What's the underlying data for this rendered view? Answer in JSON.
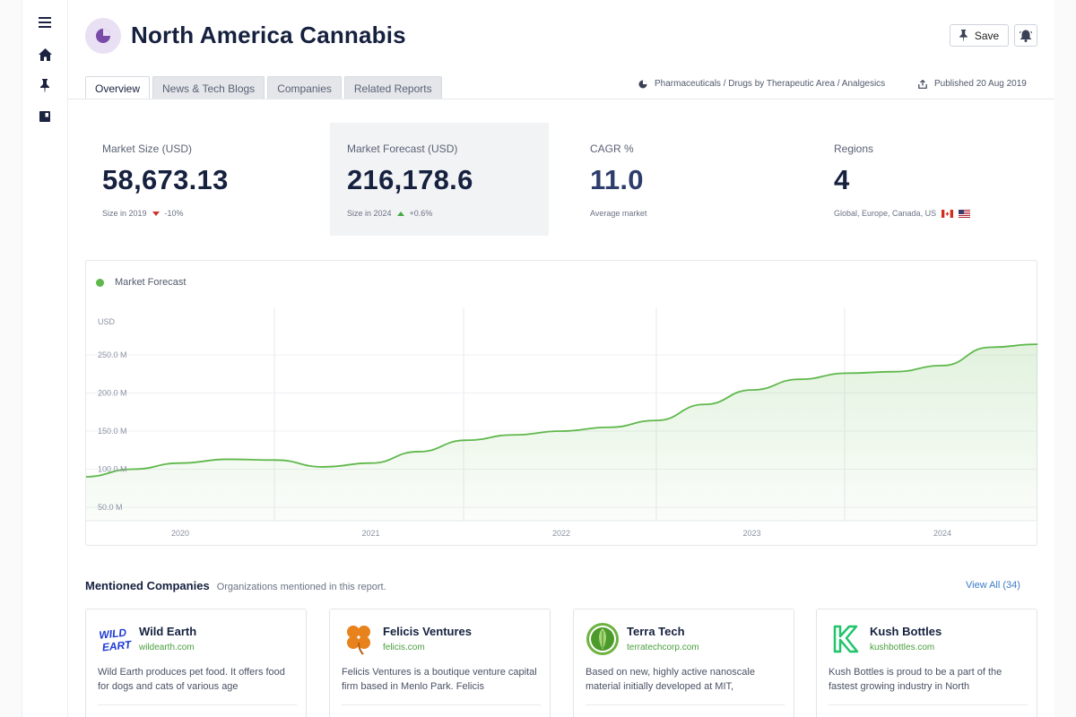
{
  "sidebar": {
    "items": [
      {
        "icon": "menu-icon"
      },
      {
        "icon": "home-icon"
      },
      {
        "icon": "pin-icon"
      },
      {
        "icon": "book-icon"
      }
    ]
  },
  "header": {
    "title": "North America Cannabis",
    "save_label": "Save"
  },
  "tabs": [
    {
      "label": "Overview",
      "active": true
    },
    {
      "label": "News & Tech Blogs",
      "active": false
    },
    {
      "label": "Companies",
      "active": false
    },
    {
      "label": "Related Reports",
      "active": false
    }
  ],
  "meta": {
    "category": "Pharmaceuticals / Drugs by Therapeutic Area / Analgesics",
    "published": "Published 20 Aug 2019"
  },
  "stats": {
    "market_size": {
      "label": "Market Size (USD)",
      "value": "58,673.13",
      "sub": "Size in 2019",
      "change": "-10%"
    },
    "market_forecast": {
      "label": "Market Forecast (USD)",
      "value": "216,178.6",
      "sub": "Size in 2024",
      "change": "+0.6%"
    },
    "cagr": {
      "label": "CAGR %",
      "value": "11.0",
      "sub": "Average market"
    },
    "regions": {
      "label": "Regions",
      "value": "4",
      "sub": "Global, Europe, Canada, US"
    }
  },
  "chart_data": {
    "type": "area",
    "legend": [
      "Market Forecast"
    ],
    "ylabel": "USD",
    "y_ticks": [
      "250.0 M",
      "200.0 M",
      "150.0 M",
      "100.0 M",
      "50.0 M"
    ],
    "x_ticks": [
      "2020",
      "2021",
      "2022",
      "2023",
      "2024"
    ],
    "ylim": [
      50,
      270
    ],
    "xlim": [
      2019.5,
      2024.5
    ],
    "series": [
      {
        "name": "Market Forecast",
        "color": "#5fb84b",
        "x": [
          2019.5,
          2019.75,
          2020.0,
          2020.25,
          2020.5,
          2020.75,
          2021.0,
          2021.25,
          2021.5,
          2021.75,
          2022.0,
          2022.25,
          2022.5,
          2022.75,
          2023.0,
          2023.25,
          2023.5,
          2023.75,
          2024.0,
          2024.25,
          2024.5
        ],
        "y": [
          90,
          100,
          108,
          113,
          112,
          103,
          108,
          123,
          138,
          145,
          150,
          155,
          164,
          185,
          204,
          218,
          226,
          228,
          236,
          260,
          264
        ]
      }
    ]
  },
  "companies": {
    "title": "Mentioned Companies",
    "subtitle": "Organizations mentioned in this report.",
    "view_all": "View All (34)",
    "items": [
      {
        "name": "Wild Earth",
        "url": "wildearth.com",
        "description": "Wild Earth produces pet food. It offers food for dogs and cats of various age",
        "logo_text": "WILD EARTH"
      },
      {
        "name": "Felicis Ventures",
        "url": "felicis.com",
        "description": "Felicis Ventures is a boutique venture capital firm based in Menlo Park. Felicis"
      },
      {
        "name": "Terra Tech",
        "url": "terratechcorp.com",
        "description": "Based on new, highly active nanoscale material initially developed at MIT,"
      },
      {
        "name": "Kush Bottles",
        "url": "kushbottles.com",
        "description": "Kush Bottles is proud to be a part of the fastest growing industry in North"
      }
    ]
  }
}
